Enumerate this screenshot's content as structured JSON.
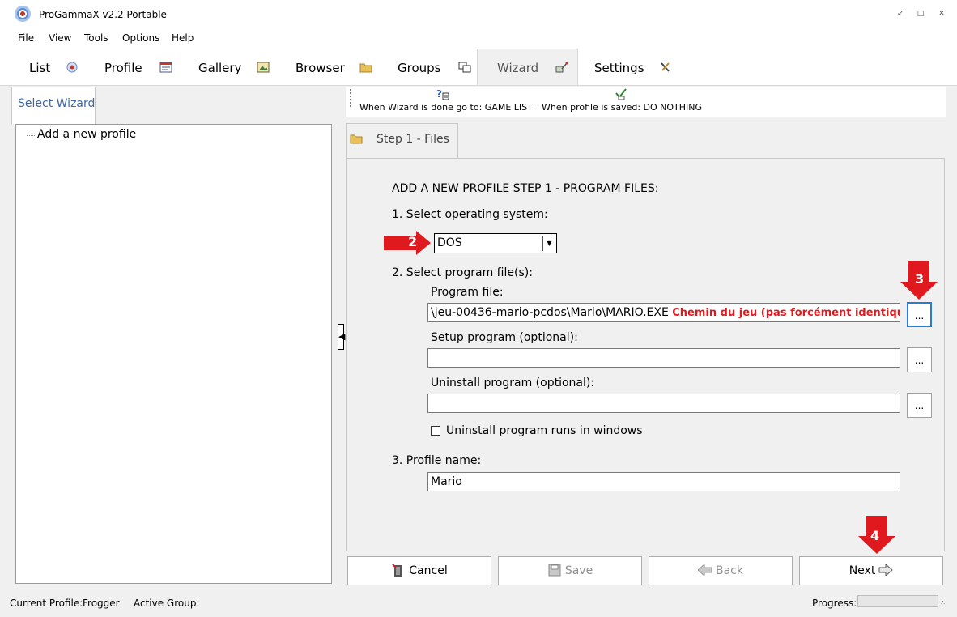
{
  "window": {
    "title": "ProGammaX v2.2 Portable"
  },
  "menu": [
    "File",
    "View",
    "Tools",
    "Options",
    "Help"
  ],
  "main_tabs": [
    "List",
    "Profile",
    "Gallery",
    "Browser",
    "Groups",
    "Wizard",
    "Settings"
  ],
  "active_main_tab": "Wizard",
  "left_panel": {
    "tab_label": "Select Wizard",
    "tree_items": [
      "Add a new profile"
    ]
  },
  "toolbar": {
    "wizard_done": "When Wizard is done go to: GAME LIST",
    "profile_saved": "When profile is saved: DO NOTHING"
  },
  "step_tab": "Step 1 - Files",
  "form": {
    "heading": "ADD A NEW PROFILE STEP 1 - PROGRAM FILES:",
    "os_label": "1. Select operating system:",
    "os_value": "DOS",
    "files_label": "2. Select program file(s):",
    "program_file_label": "Program file:",
    "program_file_value": "\\jeu-00436-mario-pcdos\\Mario\\MARIO.EXE",
    "program_file_note": "Chemin du jeu (pas forcément identique)",
    "setup_label": "Setup program (optional):",
    "setup_value": "",
    "uninstall_label": "Uninstall program (optional):",
    "uninstall_value": "",
    "browse_label": "...",
    "uninstall_windows_label": "Uninstall program runs in windows",
    "uninstall_windows_checked": false,
    "profile_name_label": "3. Profile name:",
    "profile_name_value": "Mario"
  },
  "buttons": {
    "cancel": "Cancel",
    "save": "Save",
    "back": "Back",
    "next": "Next"
  },
  "status": {
    "current_profile_label": "Current Profile:",
    "current_profile_value": "Frogger",
    "active_group_label": "Active Group:",
    "active_group_value": "",
    "progress_label": "Progress:",
    "progress_fraction": 0
  },
  "annotations": [
    "2",
    "3",
    "4"
  ],
  "colors": {
    "annotation_red": "#e0191f",
    "accent_blue": "#3c68a8",
    "focus_blue": "#2a7bd4"
  }
}
